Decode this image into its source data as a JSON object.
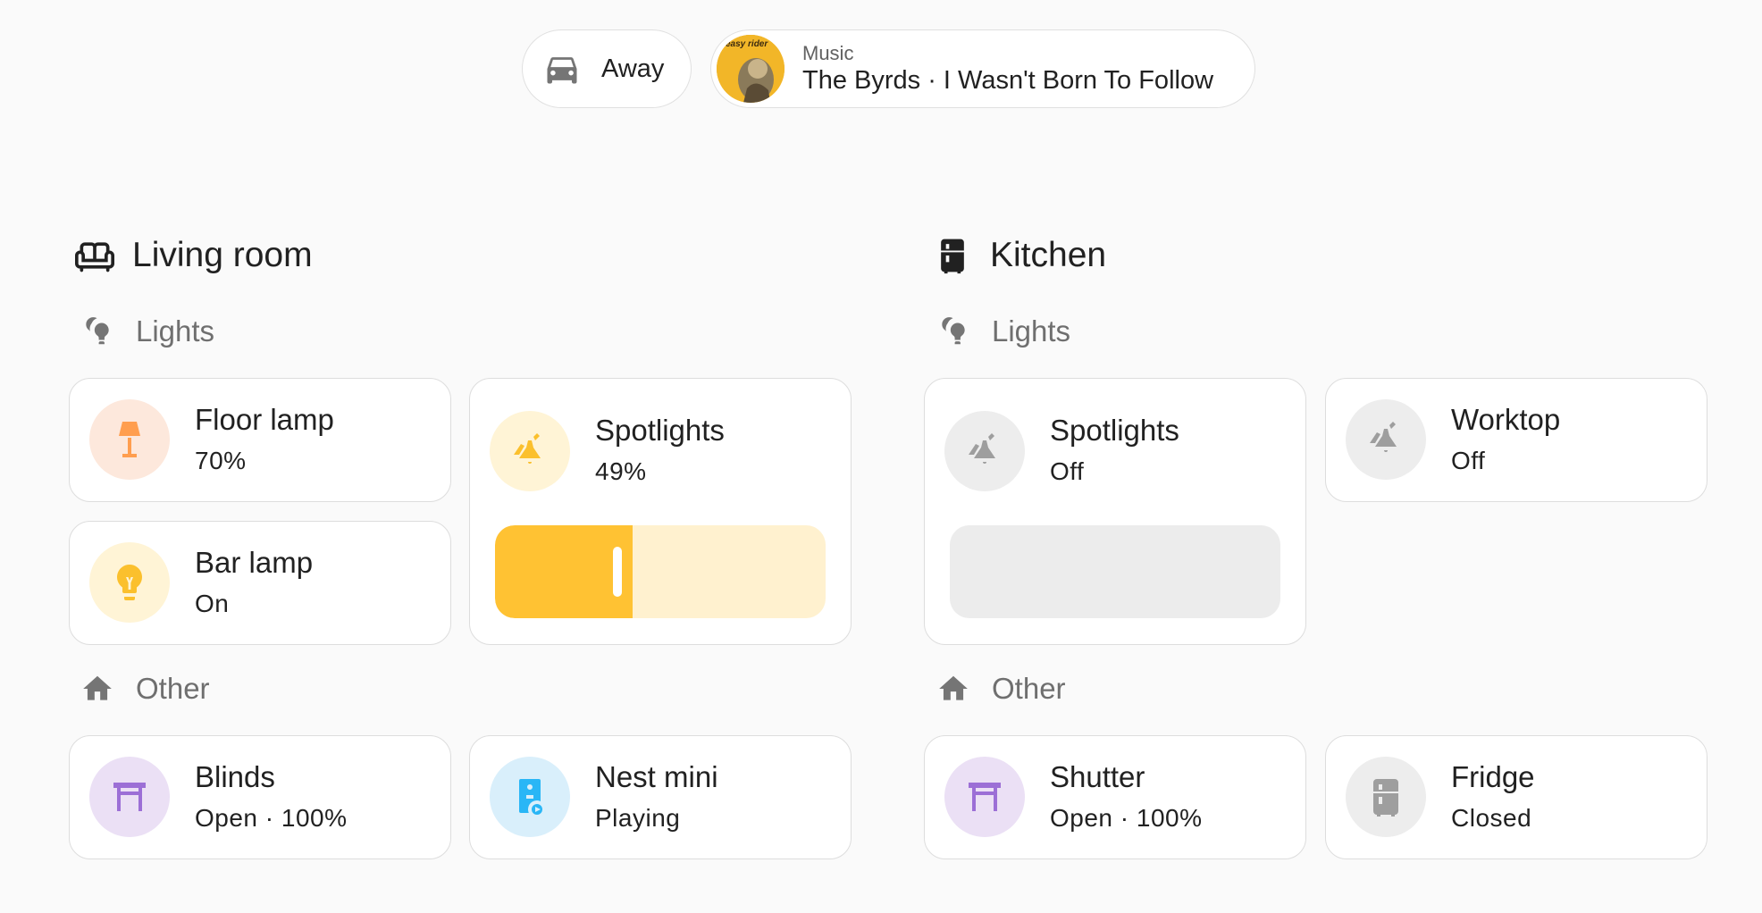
{
  "badges": {
    "away": {
      "label": "Away",
      "icon": "car-icon"
    },
    "music": {
      "label": "Music",
      "title": "The Byrds · I Wasn't Born To Follow",
      "album_art_text": "easy rider",
      "icon": "album-art"
    }
  },
  "areas": [
    {
      "title": "Living room",
      "icon": "sofa-icon",
      "groups": [
        {
          "title": "Lights",
          "icon": "lightbulb-group-icon"
        },
        {
          "title": "Other",
          "icon": "home-icon"
        }
      ],
      "lights": [
        {
          "name": "Floor lamp",
          "state": "70%",
          "icon": "floor-lamp-icon",
          "color": "#ff9e4f",
          "bg": "#fde8dc"
        },
        {
          "name": "Bar lamp",
          "state": "On",
          "icon": "lightbulb-icon",
          "color": "#fbc02d",
          "bg": "#fff4d6"
        },
        {
          "name": "Spotlights",
          "state": "49%",
          "icon": "spotlight-icon",
          "color": "#fbc02d",
          "bg": "#fff4d6",
          "brightness": 0.49
        }
      ],
      "other": [
        {
          "name": "Blinds",
          "state": "Open · 100%",
          "icon": "blinds-icon",
          "color": "#9c6fd6",
          "bg": "#ebe0f5"
        },
        {
          "name": "Nest mini",
          "state": "Playing",
          "icon": "speaker-icon",
          "color": "#29b6f6",
          "bg": "#d9effb"
        }
      ]
    },
    {
      "title": "Kitchen",
      "icon": "fridge-icon",
      "groups": [
        {
          "title": "Lights",
          "icon": "lightbulb-group-icon"
        },
        {
          "title": "Other",
          "icon": "home-icon"
        }
      ],
      "lights": [
        {
          "name": "Spotlights",
          "state": "Off",
          "icon": "spotlight-icon",
          "color": "#9e9e9e",
          "bg": "#ededed",
          "brightness": 0
        },
        {
          "name": "Worktop",
          "state": "Off",
          "icon": "spotlight-icon",
          "color": "#9e9e9e",
          "bg": "#ededed"
        }
      ],
      "other": [
        {
          "name": "Shutter",
          "state": "Open · 100%",
          "icon": "blinds-icon",
          "color": "#9c6fd6",
          "bg": "#ebe0f5"
        },
        {
          "name": "Fridge",
          "state": "Closed",
          "icon": "fridge-icon",
          "color": "#9e9e9e",
          "bg": "#ededed"
        }
      ]
    }
  ],
  "colors": {
    "slider_active": "#ffc233",
    "slider_track_on": "#fff1cf",
    "slider_track_off": "#ececec"
  }
}
